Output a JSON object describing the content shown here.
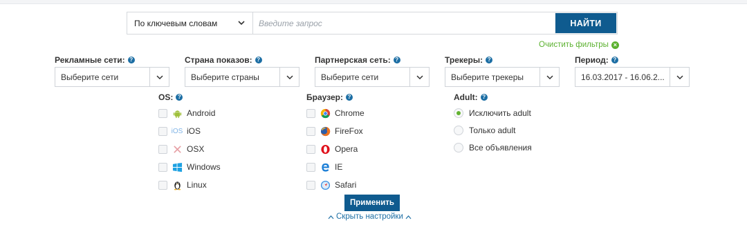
{
  "search": {
    "mode_selected": "По ключевым словам",
    "placeholder": "Введите запрос",
    "submit_label": "НАЙТИ"
  },
  "clear_filters_label": "Очистить фильтры",
  "filters": {
    "ad_networks": {
      "label": "Рекламные сети:",
      "value": "Выберите сети"
    },
    "country": {
      "label": "Страна показов:",
      "value": "Выберите страны"
    },
    "partner_network": {
      "label": "Партнерская сеть:",
      "value": "Выберите сети"
    },
    "trackers": {
      "label": "Трекеры:",
      "value": "Выберите трекеры"
    },
    "period": {
      "label": "Период:",
      "value": "16.03.2017 - 16.06.2..."
    }
  },
  "os": {
    "title": "OS:",
    "items": [
      {
        "label": "Android",
        "icon": "android-icon",
        "checked": false
      },
      {
        "label": "iOS",
        "icon": "ios-icon",
        "checked": false
      },
      {
        "label": "OSX",
        "icon": "osx-icon",
        "checked": false
      },
      {
        "label": "Windows",
        "icon": "windows-icon",
        "checked": false
      },
      {
        "label": "Linux",
        "icon": "linux-icon",
        "checked": false
      }
    ]
  },
  "browser": {
    "title": "Браузер:",
    "items": [
      {
        "label": "Chrome",
        "icon": "chrome-icon",
        "checked": false
      },
      {
        "label": "FireFox",
        "icon": "firefox-icon",
        "checked": false
      },
      {
        "label": "Opera",
        "icon": "opera-icon",
        "checked": false
      },
      {
        "label": "IE",
        "icon": "ie-icon",
        "checked": false
      },
      {
        "label": "Safari",
        "icon": "safari-icon",
        "checked": false
      }
    ]
  },
  "adult": {
    "title": "Adult:",
    "options": [
      {
        "label": "Исключить adult",
        "selected": true
      },
      {
        "label": "Только adult",
        "selected": false
      },
      {
        "label": "Все объявления",
        "selected": false
      }
    ]
  },
  "apply_label": "Применить",
  "hide_settings_label": "Скрыть настройки",
  "colors": {
    "primary": "#0f5b8f",
    "accent_green": "#5bb12f",
    "help_blue": "#1c6ea4"
  }
}
